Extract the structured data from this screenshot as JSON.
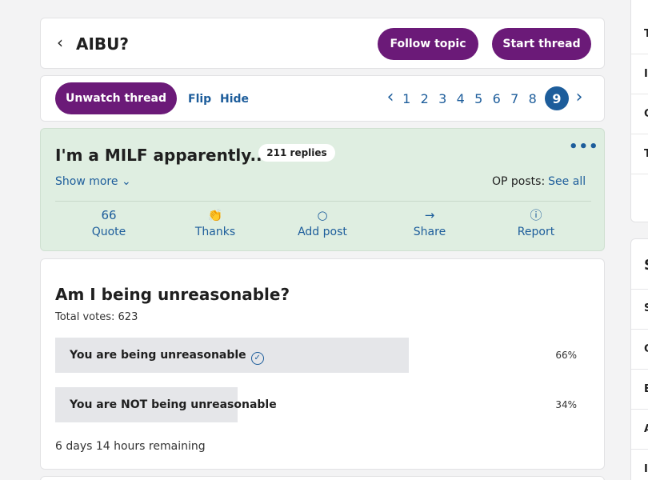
{
  "topic": {
    "back_icon": "chevron-left-icon",
    "title": "AIBU?",
    "follow_label": "Follow topic",
    "start_label": "Start thread"
  },
  "controls": {
    "unwatch_label": "Unwatch thread",
    "flip_label": "Flip",
    "hide_label": "Hide",
    "pages": [
      "1",
      "2",
      "3",
      "4",
      "5",
      "6",
      "7",
      "8"
    ],
    "current_page": "9",
    "prev_icon": "chevron-left-icon",
    "next_icon": "chevron-right-icon"
  },
  "thread": {
    "title": "I'm a MILF apparently...",
    "replies": "211 replies",
    "more_icon": "ellipsis-icon",
    "show_more": "Show more",
    "op_posts_label": "OP posts:",
    "see_all": "See all",
    "actions": [
      {
        "label": "Quote",
        "icon": "quote-icon"
      },
      {
        "label": "Thanks",
        "icon": "clap-icon"
      },
      {
        "label": "Add post",
        "icon": "speech-bubble-icon"
      },
      {
        "label": "Share",
        "icon": "share-arrow-icon"
      },
      {
        "label": "Report",
        "icon": "alert-circle-icon"
      }
    ]
  },
  "poll": {
    "question": "Am I being unreasonable?",
    "total_votes": "Total votes: 623",
    "options": [
      {
        "label": "You are being unreasonable",
        "percent": "66%",
        "share": 0.66,
        "voted": true
      },
      {
        "label": "You are NOT being unreasonable",
        "percent": "34%",
        "share": 0.34,
        "voted": false
      }
    ],
    "remaining": "6 days 14 hours remaining"
  },
  "sidebar": {
    "top_items": [
      "T",
      "I",
      "C",
      "T"
    ],
    "section_title": "S",
    "bottom_items": [
      "S",
      "C",
      "E",
      "A",
      "I"
    ]
  },
  "colors": {
    "brand_purple": "#6b1a78",
    "link_blue": "#1d5d9b",
    "thread_header_bg": "#dfeee1",
    "poll_bar": "#e5e6e9"
  }
}
